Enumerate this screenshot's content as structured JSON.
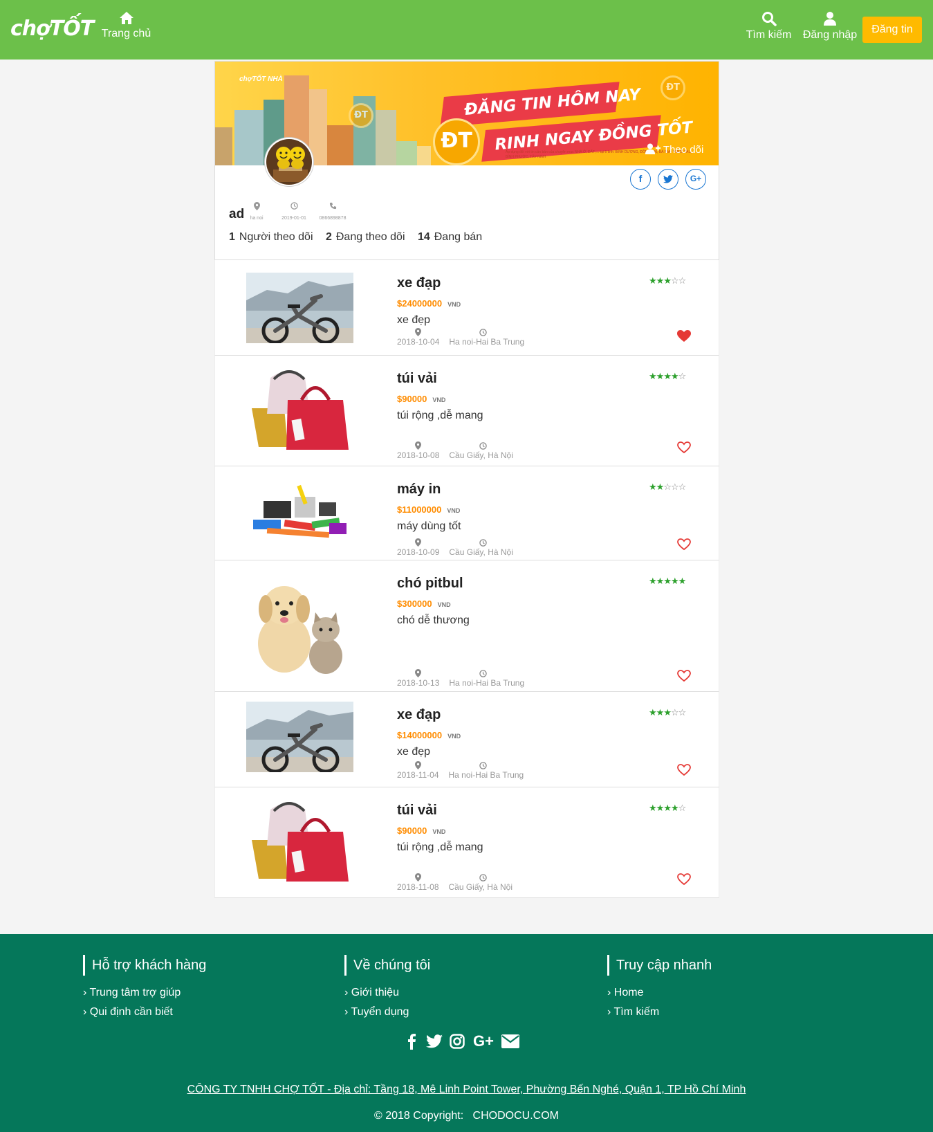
{
  "header": {
    "logo": "chợTỐT",
    "home_label": "Trang chủ",
    "search_label": "Tìm kiếm",
    "login_label": "Đăng nhập",
    "post_label": "Đăng tin"
  },
  "colors": {
    "header": "#6cc04a",
    "post_button": "#ffba00",
    "footer": "#05775a",
    "price": "#ff8c00",
    "star": "#2ca02c",
    "heart": "#e53935"
  },
  "banner": {
    "line1": "ĐĂNG TIN HÔM NAY",
    "line2": "RINH NGAY ĐỒNG TỐT",
    "coin": "ĐT",
    "logo": "chợTỐT NHÀ",
    "fineprint": "Áp dụng đối với tin cần bán của chuyên mục NHÀ Ở, ĐẤT, ... tại 5 tỉnh: BÌNH DƯƠNG, ĐỒNG NAI, BÀ RỊA - VŨNG TÀU, BÌNH PHƯỚC, TÂY NINH",
    "follow_label": "Theo dõi"
  },
  "profile": {
    "name": "ad",
    "location": "ha noi",
    "joined": "2019-01-01",
    "phone": "0866898878",
    "followers_count": "1",
    "followers_label": "Người theo dõi",
    "following_count": "2",
    "following_label": "Đang theo dõi",
    "selling_count": "14",
    "selling_label": "Đang bán",
    "social": [
      "facebook-icon",
      "twitter-icon",
      "google-plus-icon"
    ]
  },
  "listings": [
    {
      "title": "xe đạp",
      "price": "$24000000",
      "currency": "VND",
      "desc": "xe đẹp",
      "date": "2018-10-04",
      "location": "Ha noi-Hai Ba Trung",
      "rating": 3,
      "liked": true,
      "image": "bicycle"
    },
    {
      "title": "túi vải",
      "price": "$90000",
      "currency": "VND",
      "desc": "túi rộng ,dễ mang",
      "date": "2018-10-08",
      "location": "Cầu Giấy, Hà Nội",
      "rating": 4,
      "liked": false,
      "image": "bags"
    },
    {
      "title": "máy in",
      "price": "$11000000",
      "currency": "VND",
      "desc": "máy dùng tốt",
      "date": "2018-10-09",
      "location": "Cầu Giấy, Hà Nội",
      "rating": 2,
      "liked": false,
      "image": "stationery"
    },
    {
      "title": "chó pitbul",
      "price": "$300000",
      "currency": "VND",
      "desc": "chó dễ thương",
      "date": "2018-10-13",
      "location": "Ha noi-Hai Ba Trung",
      "rating": 5,
      "liked": false,
      "image": "puppy-kitten"
    },
    {
      "title": "xe đạp",
      "price": "$14000000",
      "currency": "VND",
      "desc": "xe đẹp",
      "date": "2018-11-04",
      "location": "Ha noi-Hai Ba Trung",
      "rating": 3,
      "liked": false,
      "image": "bicycle"
    },
    {
      "title": "túi vải",
      "price": "$90000",
      "currency": "VND",
      "desc": "túi rộng ,dễ mang",
      "date": "2018-11-08",
      "location": "Cầu Giấy, Hà Nội",
      "rating": 4,
      "liked": false,
      "image": "bags"
    }
  ],
  "footer": {
    "col1_title": "Hỗ trợ khách hàng",
    "col1_links": [
      "Trung tâm trợ giúp",
      "Qui định cần biết"
    ],
    "col2_title": "Về chúng tôi",
    "col2_links": [
      "Giới thiệu",
      "Tuyển dụng"
    ],
    "col3_title": "Truy cập nhanh",
    "col3_links": [
      "Home",
      "Tìm kiếm"
    ],
    "social_icons": [
      "facebook-icon",
      "twitter-icon",
      "instagram-icon",
      "google-plus-icon",
      "email-icon"
    ],
    "address": "CÔNG TY TNHH CHỢ TỐT - Địa chỉ: Tầng 18, Mê Linh Point Tower, Phường Bến Nghé, Quận 1, TP Hồ Chí Minh",
    "copyright": "© 2018 Copyright:",
    "brand": "CHODOCU.COM"
  }
}
